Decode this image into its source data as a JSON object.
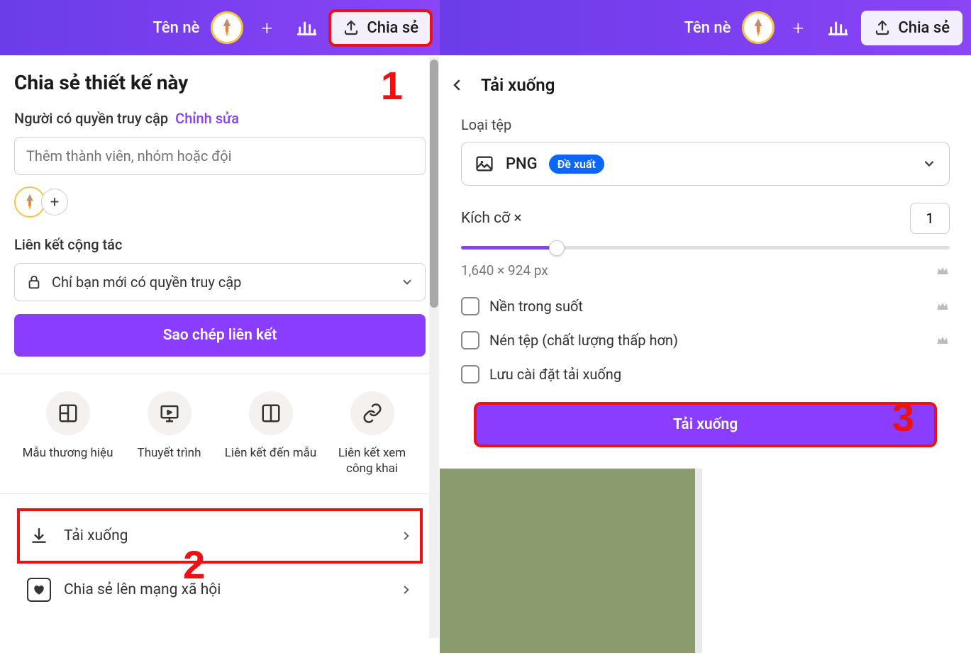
{
  "topbar": {
    "name": "Tên nè",
    "share_label": "Chia sẻ"
  },
  "left": {
    "title": "Chia sẻ thiết kế này",
    "access_label": "Người có quyền truy cập",
    "edit_link": "Chỉnh sửa",
    "member_placeholder": "Thêm thành viên, nhóm hoặc đội",
    "collab_label": "Liên kết cộng tác",
    "access_dropdown": "Chỉ bạn mới có quyền truy cập",
    "copy_link_btn": "Sao chép liên kết",
    "grid": [
      {
        "label": "Mẫu thương hiệu"
      },
      {
        "label": "Thuyết trình"
      },
      {
        "label": "Liên kết đến mẫu"
      },
      {
        "label": "Liên kết xem công khai"
      }
    ],
    "download_item": "Tải xuống",
    "social_item": "Chia sẻ lên mạng xã hội"
  },
  "right": {
    "title": "Tải xuống",
    "file_type_label": "Loại tệp",
    "file_type": "PNG",
    "suggested_badge": "Đề xuất",
    "size_label": "Kích cỡ ×",
    "size_value": "1",
    "dimensions": "1,640 × 924 px",
    "opt_transparent": "Nền trong suốt",
    "opt_compress": "Nén tệp (chất lượng thấp hơn)",
    "opt_save": "Lưu cài đặt tải xuống",
    "download_btn": "Tải xuống"
  },
  "annotations": {
    "n1": "1",
    "n2": "2",
    "n3": "3"
  }
}
